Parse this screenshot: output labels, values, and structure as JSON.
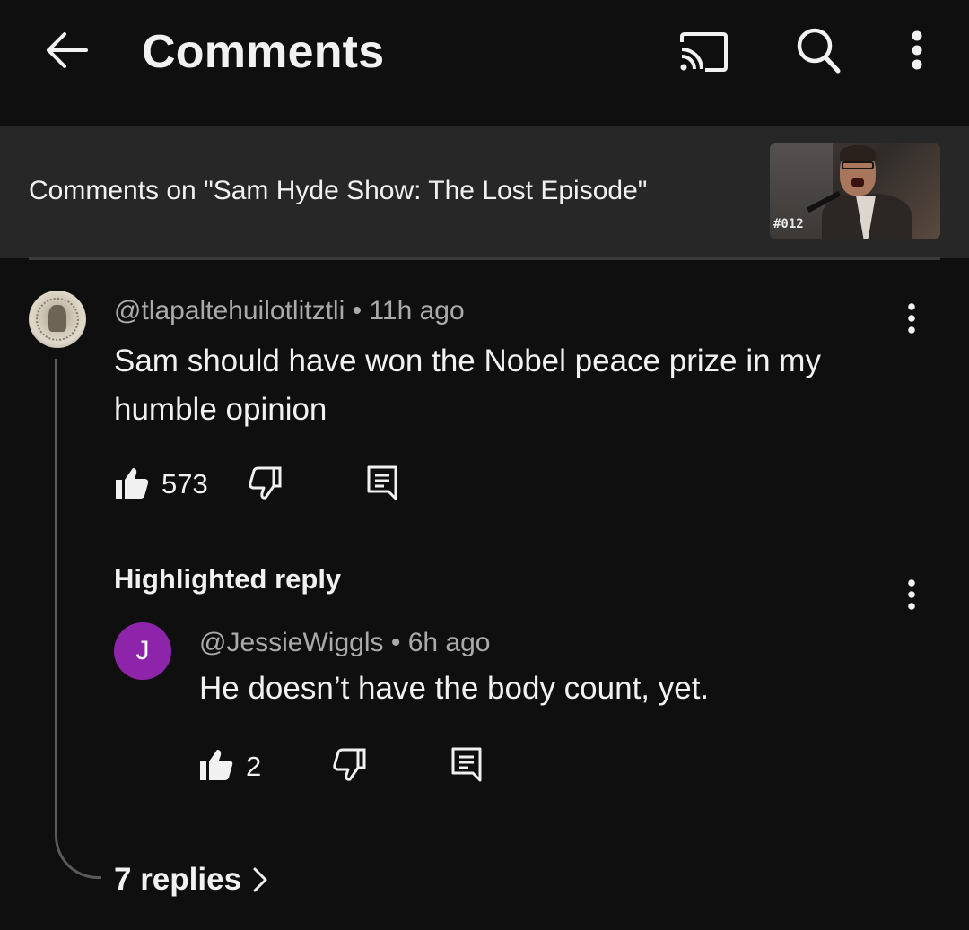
{
  "header": {
    "title": "Comments",
    "back_icon": "arrow-left-icon",
    "cast_icon": "cast-icon",
    "search_icon": "search-icon",
    "more_icon": "more-vert-icon"
  },
  "video_context": {
    "text": "Comments on \"Sam Hyde Show: The Lost Episode\"",
    "thumbnail_badge": "#012"
  },
  "comment": {
    "handle": "@tlapaltehuilotlitztli",
    "separator": "•",
    "age": "11h ago",
    "text": "Sam should have won the Nobel peace prize in my humble opinion",
    "likes": "573"
  },
  "highlighted": {
    "label": "Highlighted reply",
    "reply": {
      "avatar_letter": "J",
      "avatar_color": "#8e24aa",
      "handle": "@JessieWiggls",
      "separator": "•",
      "age": "6h ago",
      "text": "He doesn’t have the body count, yet.",
      "likes": "2"
    }
  },
  "replies": {
    "label": "7 replies"
  },
  "colors": {
    "background": "#0f0f0f",
    "context_bar": "#272727",
    "secondary_text": "#aaaaaa"
  }
}
